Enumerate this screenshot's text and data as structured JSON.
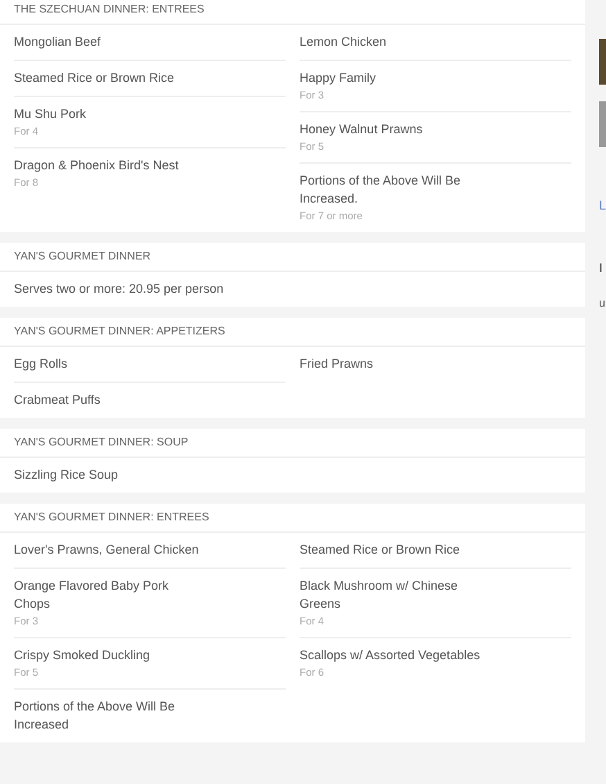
{
  "sections": [
    {
      "title": "THE SZECHUAN DINNER: ENTREES",
      "columns": [
        [
          {
            "name": "Mongolian Beef"
          },
          {
            "name": "Steamed Rice or Brown Rice"
          },
          {
            "name": "Mu Shu Pork",
            "note": "For 4"
          },
          {
            "name": "Dragon & Phoenix Bird's Nest",
            "note": "For 8"
          }
        ],
        [
          {
            "name": "Lemon Chicken"
          },
          {
            "name": "Happy Family",
            "note": "For 3"
          },
          {
            "name": "Honey Walnut Prawns",
            "note": "For 5"
          },
          {
            "name": "Portions of the Above Will Be Increased.",
            "note": "For 7 or more"
          }
        ]
      ]
    },
    {
      "title": "YAN'S GOURMET DINNER",
      "columns": [
        [
          {
            "name": "Serves two or more: 20.95 per person"
          }
        ]
      ]
    },
    {
      "title": "YAN'S GOURMET DINNER: APPETIZERS",
      "columns": [
        [
          {
            "name": "Egg Rolls"
          },
          {
            "name": "Crabmeat Puffs"
          }
        ],
        [
          {
            "name": "Fried Prawns"
          }
        ]
      ]
    },
    {
      "title": "YAN'S GOURMET DINNER: SOUP",
      "columns": [
        [
          {
            "name": "Sizzling Rice Soup"
          }
        ]
      ]
    },
    {
      "title": "YAN'S GOURMET DINNER: ENTREES",
      "columns": [
        [
          {
            "name": "Lover's Prawns, General Chicken"
          },
          {
            "name": "Orange Flavored Baby Pork Chops",
            "note": "For 3"
          },
          {
            "name": "Crispy Smoked Duckling",
            "note": "For 5"
          },
          {
            "name": "Portions of the Above Will Be Increased"
          }
        ],
        [
          {
            "name": "Steamed Rice or Brown Rice"
          },
          {
            "name": "Black Mushroom w/ Chinese Greens",
            "note": "For 4"
          },
          {
            "name": "Scallops w/ Assorted Vegetables",
            "note": "For 6"
          }
        ]
      ]
    }
  ],
  "sidebar": {
    "link": "L",
    "heading_2": "I",
    "text_lines": [
      "u"
    ]
  }
}
